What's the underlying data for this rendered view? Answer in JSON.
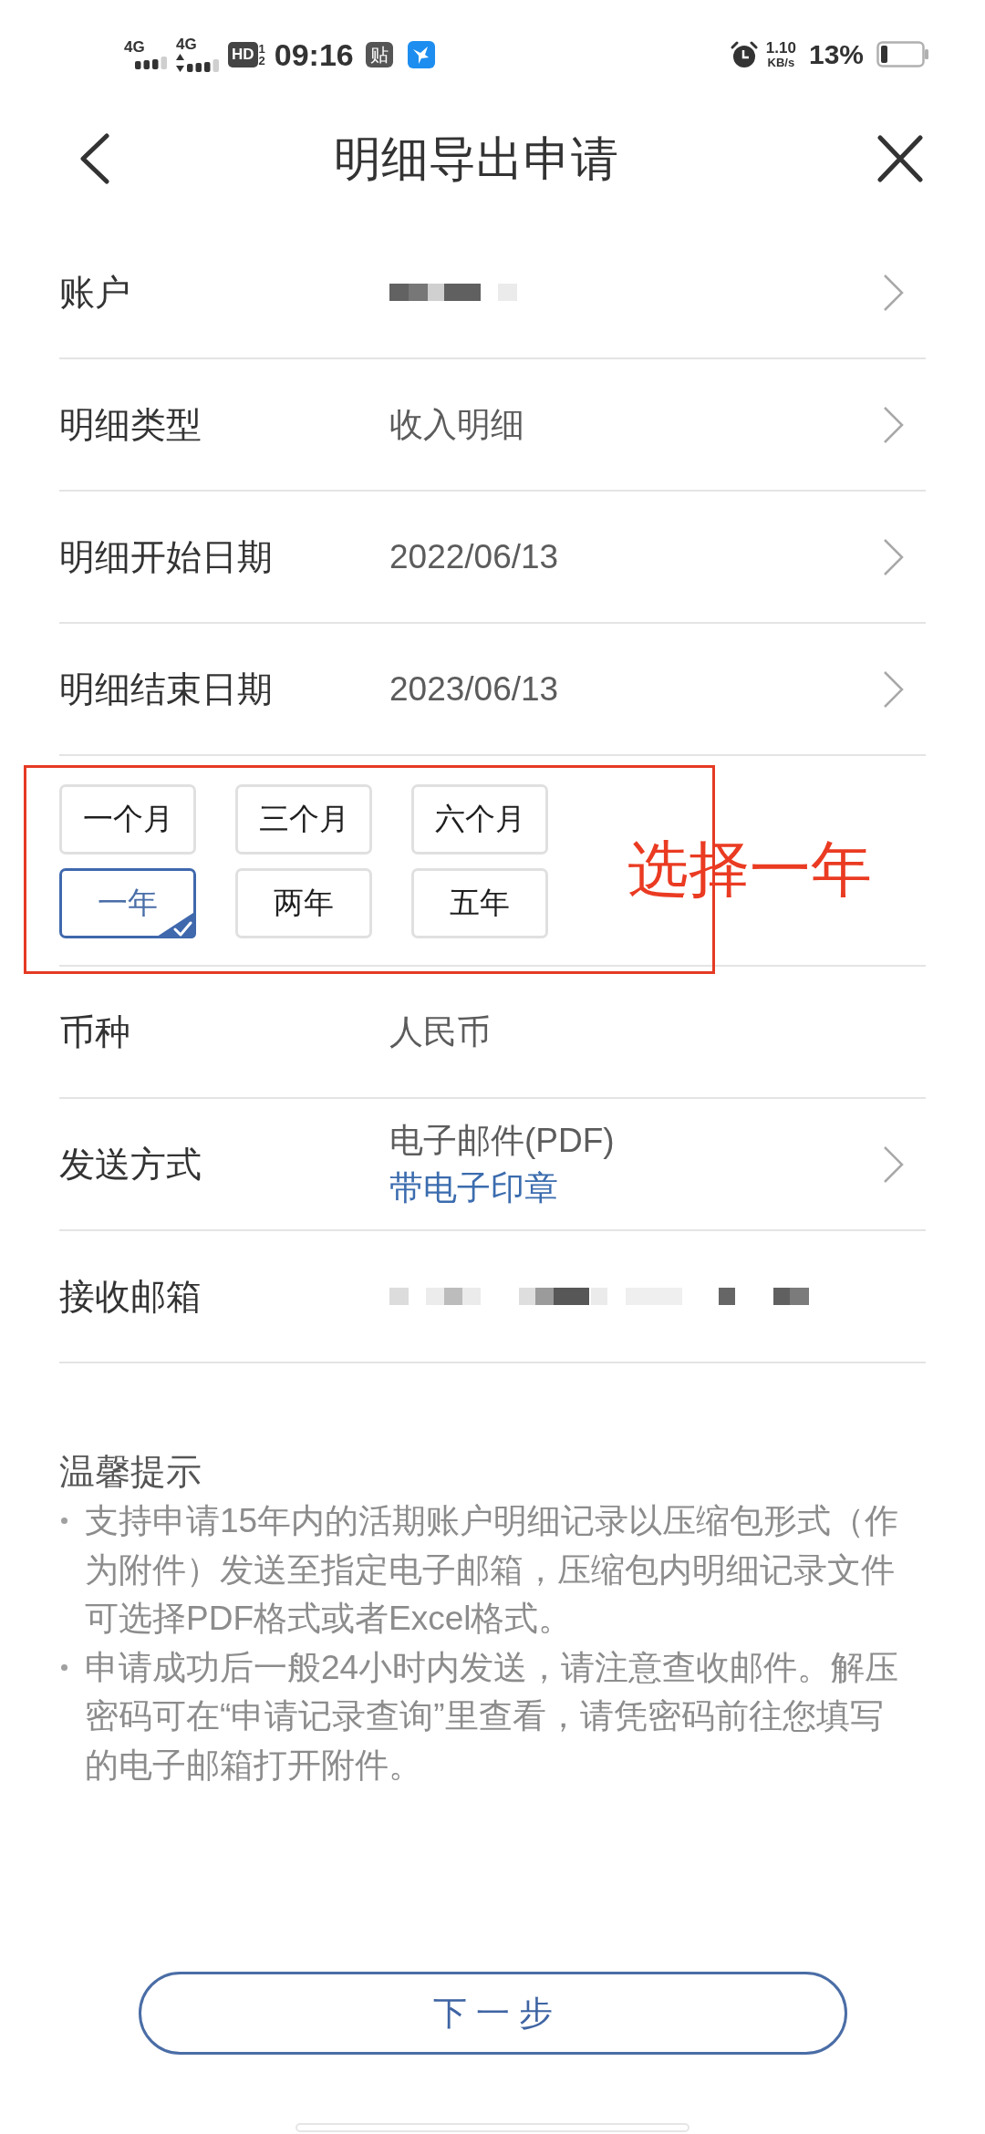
{
  "status_bar": {
    "signals": [
      {
        "label": "4G",
        "data_arrows": false
      },
      {
        "label": "4G",
        "data_arrows": true
      }
    ],
    "hd": {
      "label": "HD",
      "sims": [
        "1",
        "2"
      ]
    },
    "time": "09:16",
    "notifications": [
      {
        "kind": "text",
        "text": "贴"
      },
      {
        "kind": "app"
      }
    ],
    "speed": {
      "value": "1.10",
      "unit": "KB/s"
    },
    "battery": "13%"
  },
  "nav": {
    "title": "明细导出申请"
  },
  "form": {
    "rows": [
      {
        "kind": "masked",
        "label": "账户",
        "chevron": true
      },
      {
        "kind": "text",
        "label": "明细类型",
        "value": "收入明细",
        "chevron": true
      },
      {
        "kind": "text",
        "label": "明细开始日期",
        "value": "2022/06/13",
        "chevron": true
      },
      {
        "kind": "text",
        "label": "明细结束日期",
        "value": "2023/06/13",
        "chevron": true
      },
      {
        "kind": "periods",
        "options": [
          {
            "label": "一个月",
            "selected": false
          },
          {
            "label": "三个月",
            "selected": false
          },
          {
            "label": "六个月",
            "selected": false
          },
          {
            "label": "一年",
            "selected": true
          },
          {
            "label": "两年",
            "selected": false
          },
          {
            "label": "五年",
            "selected": false
          }
        ],
        "annotation": "选择一年"
      },
      {
        "kind": "text",
        "label": "币种",
        "value": "人民币",
        "chevron": false
      },
      {
        "kind": "text",
        "label": "发送方式",
        "value": "电子邮件(PDF)",
        "note": "带电子印章",
        "chevron": true
      },
      {
        "kind": "masked",
        "label": "接收邮箱",
        "chevron": false
      }
    ]
  },
  "tips": {
    "title": "温馨提示",
    "items": [
      "支持申请15年内的活期账户明细记录以压缩包形式（作为附件）发送至指定电子邮箱，压缩包内明细记录文件可选择PDF格式或者Excel格式。",
      "申请成功后一般24小时内发送，请注意查收邮件。解压密码可在“申请记录查询”里查看，请凭密码前往您填写的电子邮箱打开附件。"
    ]
  },
  "next_button": "下一步"
}
